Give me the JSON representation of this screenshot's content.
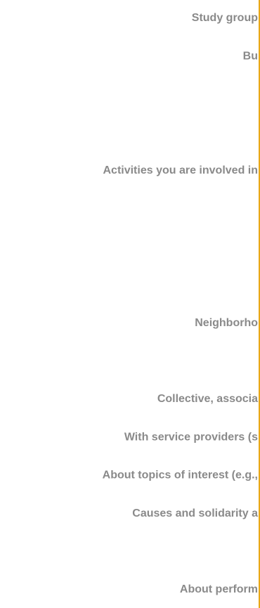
{
  "chart_data": {
    "type": "bar",
    "orientation": "horizontal",
    "categories": [
      "Study group",
      "Bu",
      "",
      "",
      "Activities you are involved in",
      "",
      "",
      "",
      "Neighborho",
      "",
      "Collective, associa",
      "With service providers (s",
      "About topics of interest (e.g.,",
      "Causes and solidarity a",
      "",
      "About perform"
    ],
    "values": [
      null,
      null,
      null,
      null,
      null,
      null,
      null,
      null,
      null,
      null,
      null,
      null,
      null,
      null,
      null,
      null
    ],
    "title": "",
    "xlabel": "",
    "ylabel": "",
    "grid": false,
    "colors": {
      "axis": "#e8a817",
      "label": "#8a8a8a",
      "background": "#ffffff"
    }
  }
}
